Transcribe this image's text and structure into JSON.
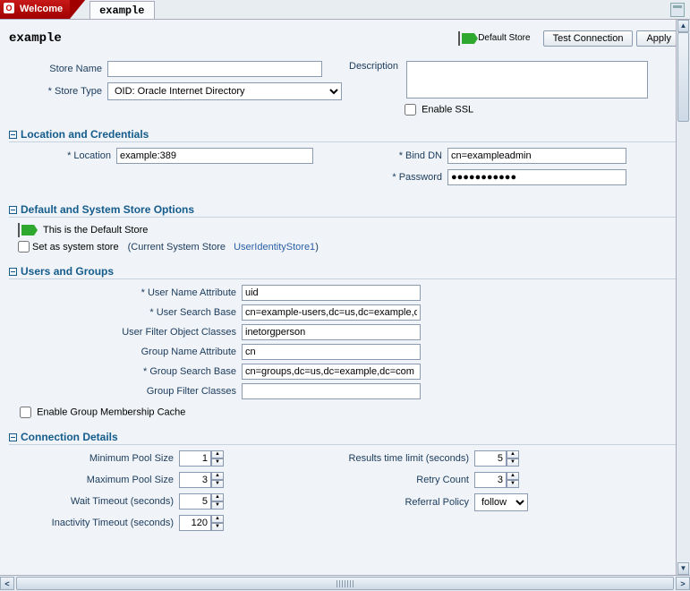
{
  "tabs": {
    "welcome": "Welcome",
    "example": "example"
  },
  "page_title": "example",
  "header": {
    "default_store": "Default Store",
    "test_connection": "Test Connection",
    "apply": "Apply"
  },
  "basic": {
    "store_name_label": "Store Name",
    "store_name_value": "",
    "store_type_label": "Store Type",
    "store_type_value": "OID: Oracle Internet Directory",
    "description_label": "Description",
    "description_value": "",
    "enable_ssl_label": "Enable SSL",
    "enable_ssl_checked": false
  },
  "sections": {
    "location": "Location and Credentials",
    "defaults": "Default and System Store Options",
    "users_groups": "Users and Groups",
    "connection": "Connection Details"
  },
  "location": {
    "location_label": "Location",
    "location_value": "example:389",
    "bind_dn_label": "Bind DN",
    "bind_dn_value": "cn=exampleadmin",
    "password_label": "Password",
    "password_value": "●●●●●●●●●●●"
  },
  "defaults": {
    "is_default_text": "This is the Default Store",
    "set_system_label": "Set as system store",
    "set_system_checked": false,
    "current_system_prefix": "(Current System Store",
    "current_system_link": "UserIdentityStore1",
    "current_system_suffix": ")"
  },
  "users_groups": {
    "user_name_attr_label": "User Name Attribute",
    "user_name_attr_value": "uid",
    "user_search_base_label": "User Search Base",
    "user_search_base_value": "cn=example-users,dc=us,dc=example,dc=cc",
    "user_filter_label": "User Filter Object Classes",
    "user_filter_value": "inetorgperson",
    "group_name_attr_label": "Group Name Attribute",
    "group_name_attr_value": "cn",
    "group_search_base_label": "Group Search Base",
    "group_search_base_value": "cn=groups,dc=us,dc=example,dc=com",
    "group_filter_label": "Group Filter Classes",
    "group_filter_value": "",
    "enable_cache_label": "Enable Group Membership Cache",
    "enable_cache_checked": false
  },
  "connection": {
    "min_pool_label": "Minimum Pool Size",
    "min_pool_value": "1",
    "max_pool_label": "Maximum Pool Size",
    "max_pool_value": "3",
    "wait_timeout_label": "Wait Timeout (seconds)",
    "wait_timeout_value": "5",
    "inactivity_label": "Inactivity Timeout (seconds)",
    "inactivity_value": "120",
    "results_limit_label": "Results time limit (seconds)",
    "results_limit_value": "5",
    "retry_count_label": "Retry Count",
    "retry_count_value": "3",
    "referral_label": "Referral Policy",
    "referral_value": "follow"
  }
}
